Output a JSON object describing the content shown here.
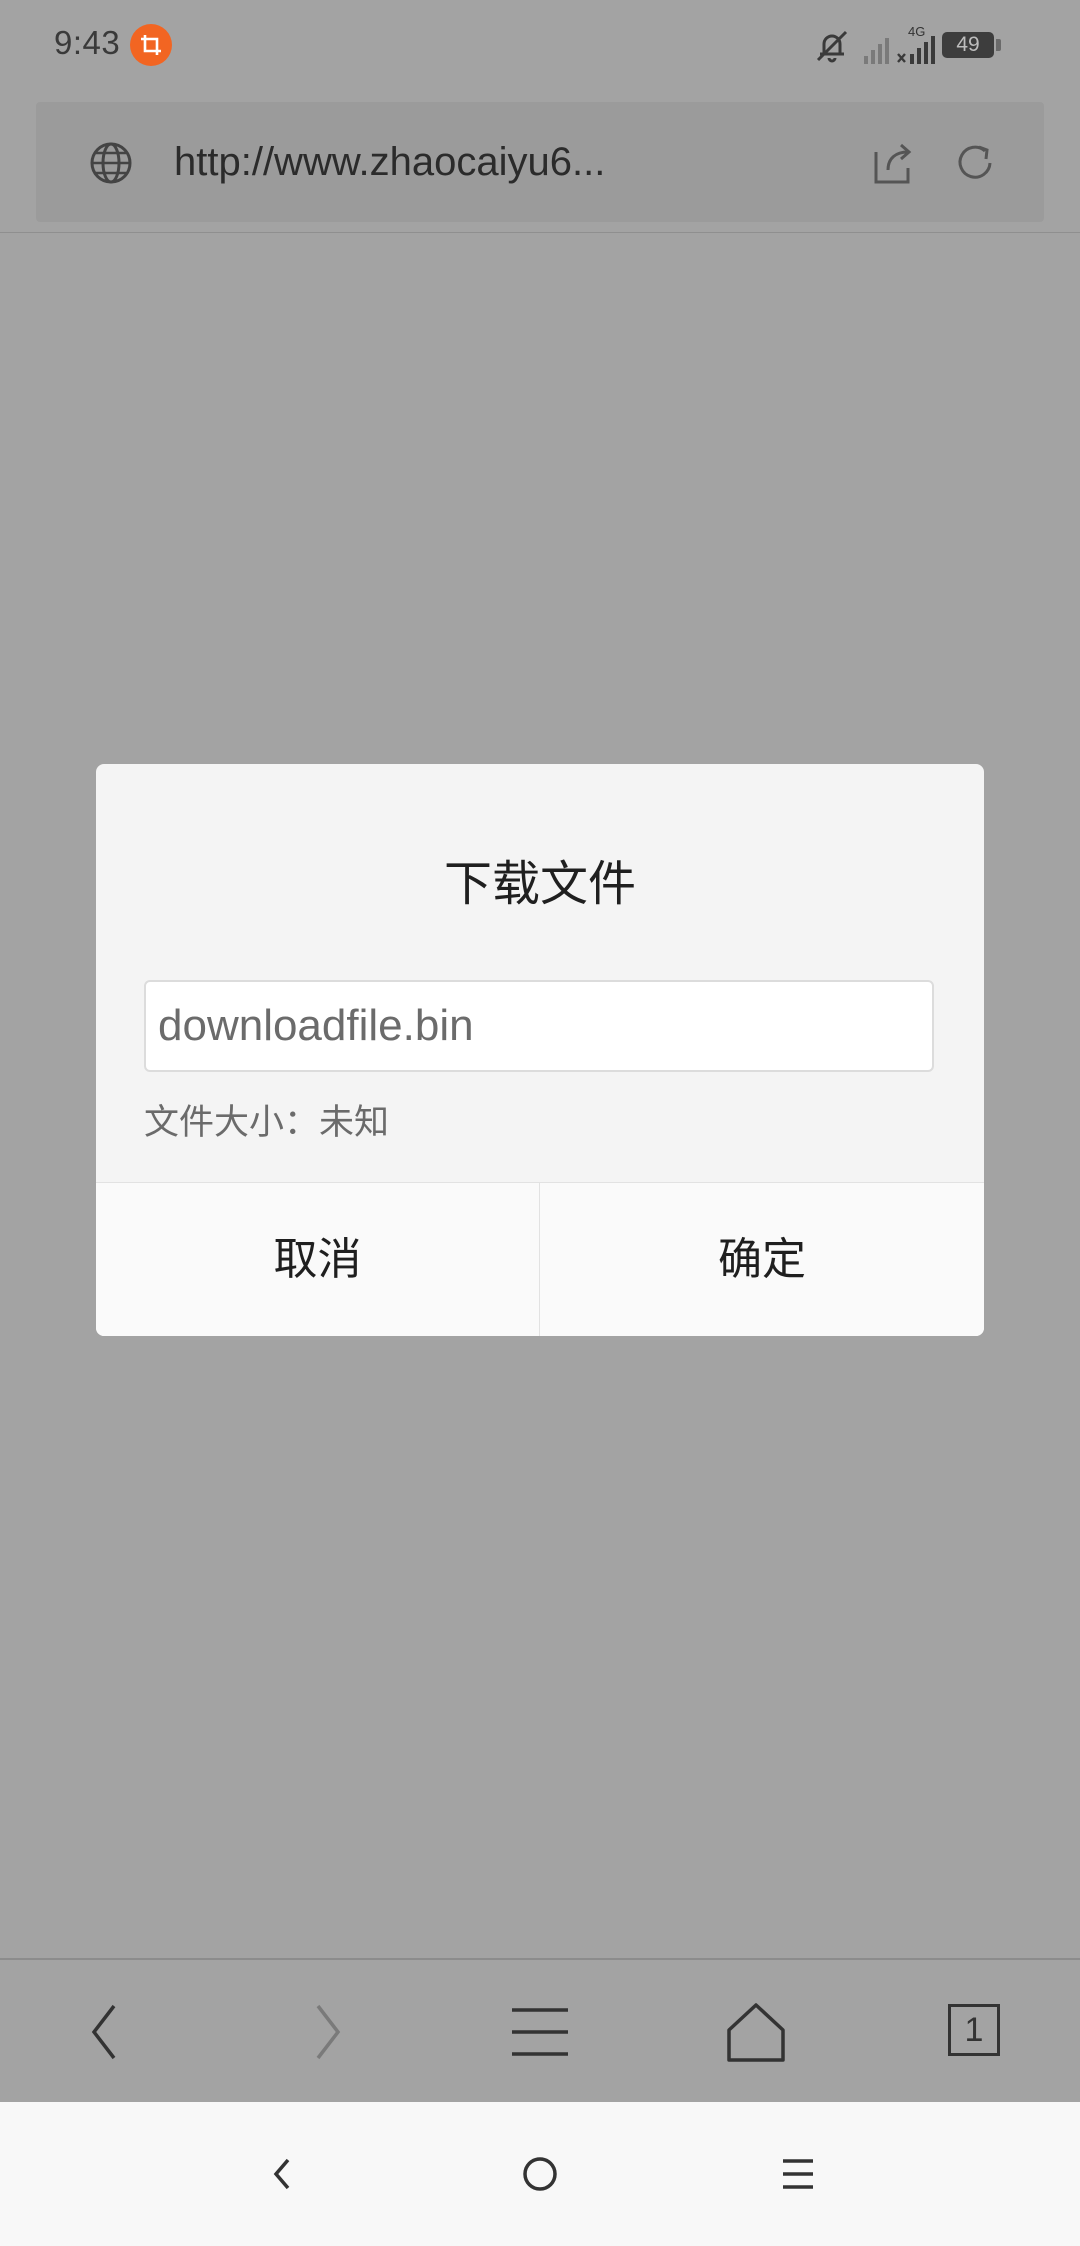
{
  "status_bar": {
    "time": "9:43",
    "network": "4G",
    "battery": "49",
    "icons": [
      "screenshot-icon",
      "mute-bell-icon",
      "signal-icon",
      "signal-4g-icon",
      "battery-icon"
    ]
  },
  "browser": {
    "url": "http://www.zhaocaiyu6...",
    "icons": [
      "globe-icon",
      "share-icon",
      "refresh-icon"
    ]
  },
  "dialog": {
    "title": "下载文件",
    "filename": "downloadfile.bin",
    "filesize_label": "文件大小：",
    "filesize_value": "未知",
    "cancel_label": "取消",
    "ok_label": "确定"
  },
  "bottom_nav": {
    "tab_count": "1",
    "icons": [
      "back-icon",
      "forward-icon",
      "menu-icon",
      "home-icon",
      "tabs-icon"
    ]
  },
  "system_nav": {
    "icons": [
      "system-back-icon",
      "system-home-icon",
      "system-menu-icon"
    ]
  },
  "colors": {
    "overlay_background": "#a3a3a3",
    "dialog_background": "#f4f4f4",
    "screenshot_badge": "#f26522"
  }
}
